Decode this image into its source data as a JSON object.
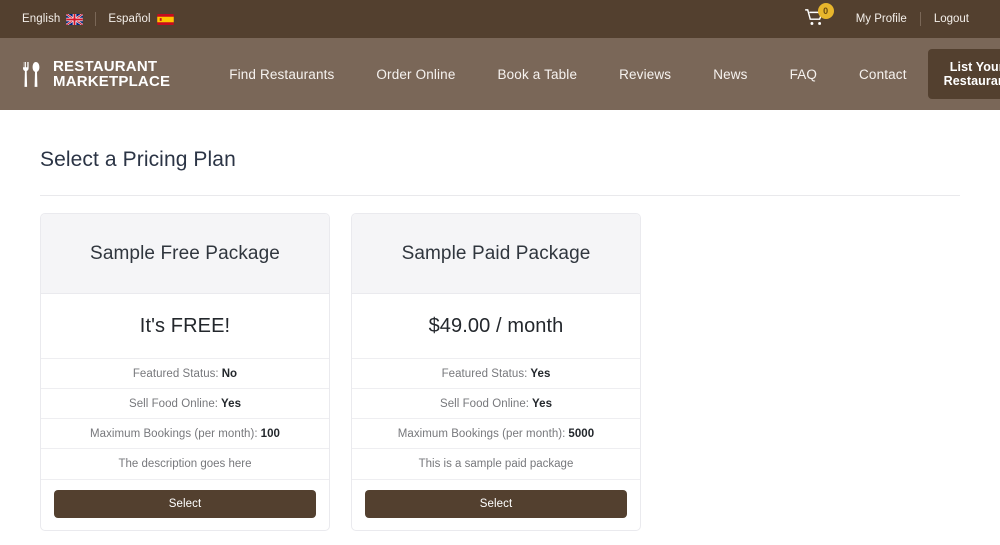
{
  "topbar": {
    "languages": [
      {
        "label": "English",
        "flag": "uk-flag-icon"
      },
      {
        "label": "Español",
        "flag": "spain-flag-icon"
      }
    ],
    "cart": {
      "icon": "shopping-cart-icon",
      "count": "0"
    },
    "profile_label": "My Profile",
    "logout_label": "Logout"
  },
  "navbar": {
    "logo": {
      "icon": "fork-and-spoon-icon",
      "line1": "RESTAURANT",
      "line2": "MARKETPLACE"
    },
    "links": [
      {
        "label": "Find Restaurants"
      },
      {
        "label": "Order Online"
      },
      {
        "label": "Book a Table"
      },
      {
        "label": "Reviews"
      },
      {
        "label": "News"
      },
      {
        "label": "FAQ"
      },
      {
        "label": "Contact"
      }
    ],
    "cta_label": "List Your Restaurant"
  },
  "page": {
    "title": "Select a Pricing Plan"
  },
  "plans": [
    {
      "name": "Sample Free Package",
      "price": "It's FREE!",
      "features": [
        {
          "label": "Featured Status:",
          "value": "No"
        },
        {
          "label": "Sell Food Online:",
          "value": "Yes"
        },
        {
          "label": "Maximum Bookings (per month):",
          "value": "100"
        }
      ],
      "description": "The description goes here",
      "select_label": "Select"
    },
    {
      "name": "Sample Paid Package",
      "price": "$49.00 / month",
      "features": [
        {
          "label": "Featured Status:",
          "value": "Yes"
        },
        {
          "label": "Sell Food Online:",
          "value": "Yes"
        },
        {
          "label": "Maximum Bookings (per month):",
          "value": "5000"
        }
      ],
      "description": "This is a sample paid package",
      "select_label": "Select"
    }
  ],
  "colors": {
    "topbar_bg": "#53402f",
    "nav_bg": "#7a6758",
    "button_bg": "#53402f",
    "badge_bg": "#e8b62c",
    "title_color": "#2b3445"
  }
}
